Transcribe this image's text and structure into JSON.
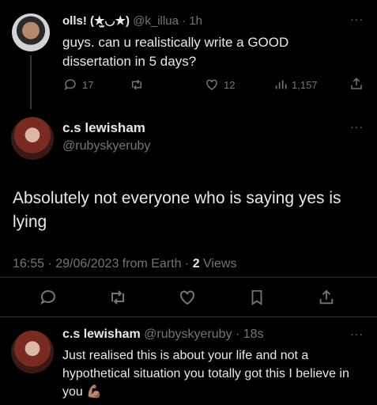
{
  "tweet1": {
    "display_name": "olls! (★̫◡★)",
    "handle": "@k_illua",
    "time": "1h",
    "text": "guys. can u realistically write a GOOD dissertation in 5 days?",
    "replies": "17",
    "likes": "12",
    "views": "1,157"
  },
  "main_tweet": {
    "display_name": "c.s lewisham",
    "handle": "@rubyskyeruby",
    "text": "Absolutely not everyone who is saying yes is lying",
    "timestamp": "16:55 · 29/06/2023 from Earth · ",
    "views_count": "2",
    "views_label": "Views"
  },
  "reply": {
    "display_name": "c.s lewisham",
    "handle": "@rubyskyeruby",
    "time": "18s",
    "text": "Just realised this is about your life and not a hypothetical situation you totally got this I believe in you",
    "emoji": "💪🏽"
  },
  "more_glyph": "···",
  "colors": {
    "background": "#000000",
    "text": "#e7e9ea",
    "muted": "#71767b",
    "divider": "#2f3336"
  }
}
